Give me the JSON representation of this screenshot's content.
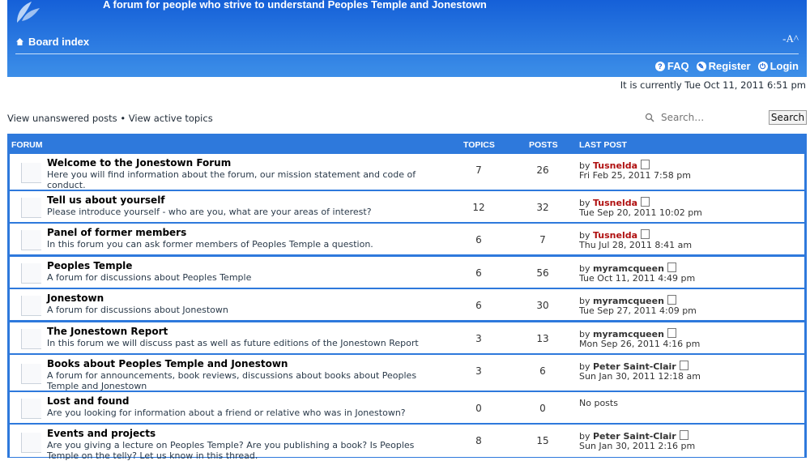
{
  "header": {
    "tagline": "A forum for people who strive to understand Peoples Temple and Jonestown",
    "board_index": "Board index",
    "font_size": "-A^",
    "faq": "FAQ",
    "register": "Register",
    "login": "Login"
  },
  "current_time": "It is currently Tue Oct 11, 2011 6:51 pm",
  "quick_links": {
    "unanswered": "View unanswered posts",
    "separator": "•",
    "active": "View active topics"
  },
  "search": {
    "placeholder": "Search…",
    "button": "Search"
  },
  "table": {
    "col_forum": "FORUM",
    "col_topics": "TOPICS",
    "col_posts": "POSTS",
    "col_last": "LAST POST"
  },
  "forums": [
    {
      "title": "Welcome to the Jonestown Forum",
      "desc": "Here you will find information about the forum, our mission statement and code of conduct.",
      "topics": "7",
      "posts": "26",
      "by": "by",
      "author": "Tusnelda",
      "date": "Fri Feb 25, 2011 7:58 pm"
    },
    {
      "title": "Tell us about yourself",
      "desc": "Please introduce yourself - who are you, what are your areas of interest?",
      "topics": "12",
      "posts": "32",
      "by": "by",
      "author": "Tusnelda",
      "date": "Tue Sep 20, 2011 10:02 pm"
    },
    {
      "title": "Panel of former members",
      "desc": "In this forum you can ask former members of Peoples Temple a question.",
      "topics": "6",
      "posts": "7",
      "by": "by",
      "author": "Tusnelda",
      "date": "Thu Jul 28, 2011 8:41 am"
    },
    {
      "title": "Peoples Temple",
      "desc": "A forum for discussions about Peoples Temple",
      "topics": "6",
      "posts": "56",
      "by": "by",
      "author": "myramcqueen",
      "date": "Tue Oct 11, 2011 4:49 pm"
    },
    {
      "title": "Jonestown",
      "desc": "A forum for discussions about Jonestown",
      "topics": "6",
      "posts": "30",
      "by": "by",
      "author": "myramcqueen",
      "date": "Tue Sep 27, 2011 4:09 pm"
    },
    {
      "title": "The Jonestown Report",
      "desc": "In this forum we will discuss past as well as future editions of the Jonestown Report",
      "topics": "3",
      "posts": "13",
      "by": "by",
      "author": "myramcqueen",
      "date": "Mon Sep 26, 2011 4:16 pm"
    },
    {
      "title": "Books about Peoples Temple and Jonestown",
      "desc": "A forum for announcements, book reviews, discussions about books about Peoples Temple and Jonestown",
      "topics": "3",
      "posts": "6",
      "by": "by",
      "author": "Peter Saint-Clair",
      "date": "Sun Jan 30, 2011 12:18 am"
    },
    {
      "title": "Lost and found",
      "desc": "Are you looking for information about a friend or relative who was in Jonestown?",
      "topics": "0",
      "posts": "0",
      "no_posts": "No posts"
    },
    {
      "title": "Events and projects",
      "desc": "Are you giving a lecture on Peoples Temple? Are you publishing a book? Is Peoples Temple on the telly? Let us know in this thread.",
      "topics": "8",
      "posts": "15",
      "by": "by",
      "author": "Peter Saint-Clair",
      "date": "Sun Jan 30, 2011 2:16 pm"
    }
  ],
  "colors": {
    "header_top": "#1560d8",
    "header_bottom": "#3d8fe8",
    "author_red": "#b01010"
  },
  "icons": [
    "leaf-logo-icon",
    "home-icon",
    "faq-icon",
    "register-icon",
    "login-icon",
    "magnifier-icon",
    "forum-read-icon",
    "view-latest-post-icon"
  ]
}
